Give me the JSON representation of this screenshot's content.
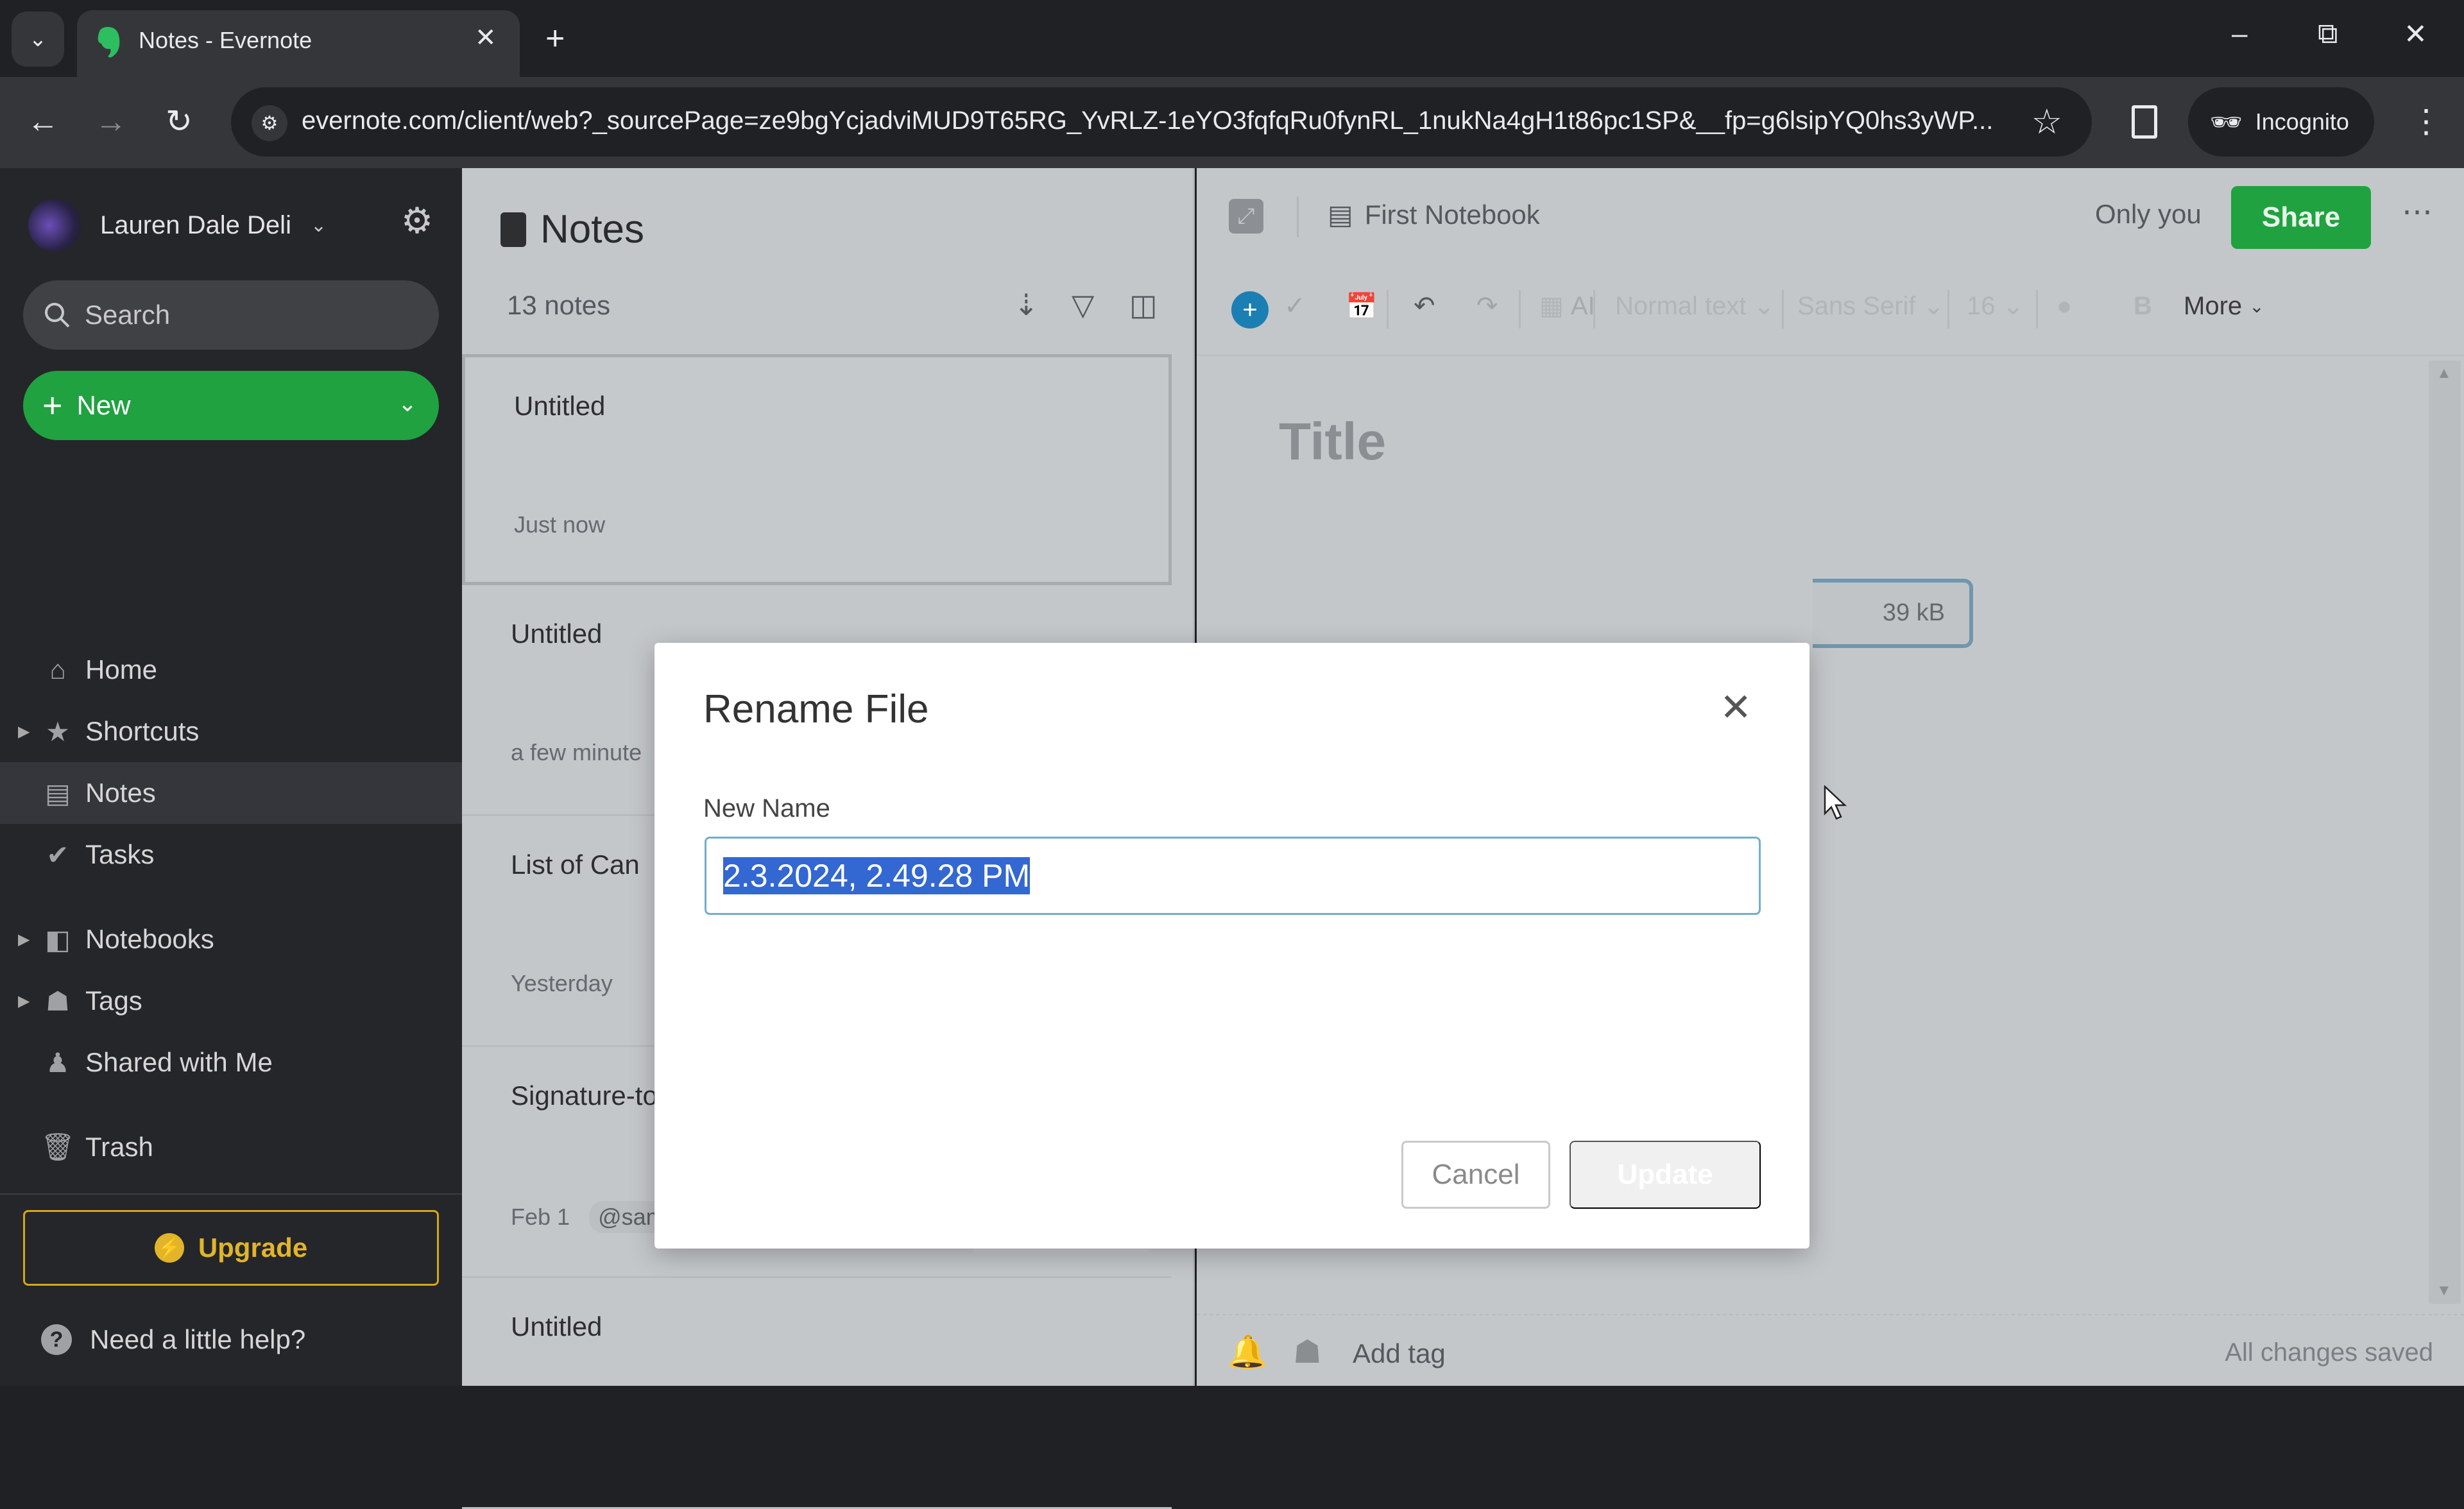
{
  "browser": {
    "tab_title": "Notes - Evernote",
    "url": "evernote.com/client/web?_sourcePage=ze9bgYcjadviMUD9T65RG_YvRLZ-1eYO3fqfqRu0fynRL_1nukNa4gH1t86pc1SP&__fp=g6lsipYQ0hs3yWP...",
    "incognito_label": "Incognito",
    "icons": {
      "tab_list": "chevron-down-icon",
      "close_tab": "close-icon",
      "new_tab": "plus-icon",
      "back": "arrow-left-icon",
      "forward": "arrow-right-icon",
      "reload": "reload-icon",
      "site_info": "tune-icon",
      "bookmark": "star-icon",
      "side_panel": "side-panel-icon",
      "menu": "kebab-icon"
    }
  },
  "sidebar": {
    "user_name": "Lauren Dale Deli",
    "search_placeholder": "Search",
    "new_label": "New",
    "items": [
      {
        "label": "Home",
        "icon": "home-icon",
        "expandable": false
      },
      {
        "label": "Shortcuts",
        "icon": "star-icon",
        "expandable": true
      },
      {
        "label": "Notes",
        "icon": "note-icon",
        "expandable": false,
        "active": true
      },
      {
        "label": "Tasks",
        "icon": "check-circle-icon",
        "expandable": false
      },
      {
        "label": "Notebooks",
        "icon": "notebook-icon",
        "expandable": true
      },
      {
        "label": "Tags",
        "icon": "tag-icon",
        "expandable": true
      },
      {
        "label": "Shared with Me",
        "icon": "people-icon",
        "expandable": false
      },
      {
        "label": "Trash",
        "icon": "trash-icon",
        "expandable": false
      }
    ],
    "upgrade_label": "Upgrade",
    "help_label": "Need a little help?"
  },
  "note_list": {
    "title": "Notes",
    "count": "13 notes",
    "notes": [
      {
        "title": "Untitled",
        "meta": "Just now",
        "tag": ""
      },
      {
        "title": "Untitled",
        "meta": "a few minute",
        "tag": ""
      },
      {
        "title": "List of Can",
        "meta": "Yesterday",
        "tag": ""
      },
      {
        "title": "Signature-to be attached",
        "meta": "Feb 1",
        "tag": "@sam"
      },
      {
        "title": "Untitled",
        "meta": "",
        "tag": ""
      }
    ]
  },
  "editor": {
    "notebook": "First Notebook",
    "visibility": "Only you",
    "share_label": "Share",
    "toolbar": {
      "ai_label": "AI",
      "style": "Normal text",
      "font": "Sans Serif",
      "size": "16",
      "bold": "B",
      "more_label": "More"
    },
    "title_placeholder": "Title",
    "attachment_size": "39 kB",
    "add_tag": "Add tag",
    "status": "All changes saved"
  },
  "modal": {
    "title": "Rename File",
    "field_label": "New Name",
    "field_value": "2.3.2024, 2.49.28 PM",
    "cancel_label": "Cancel",
    "update_label": "Update"
  },
  "colors": {
    "brand_green": "#1fa23f",
    "upgrade_gold": "#e2b42a",
    "accent_blue": "#1b7fb4",
    "selection_highlight": "#ccf0fb"
  }
}
